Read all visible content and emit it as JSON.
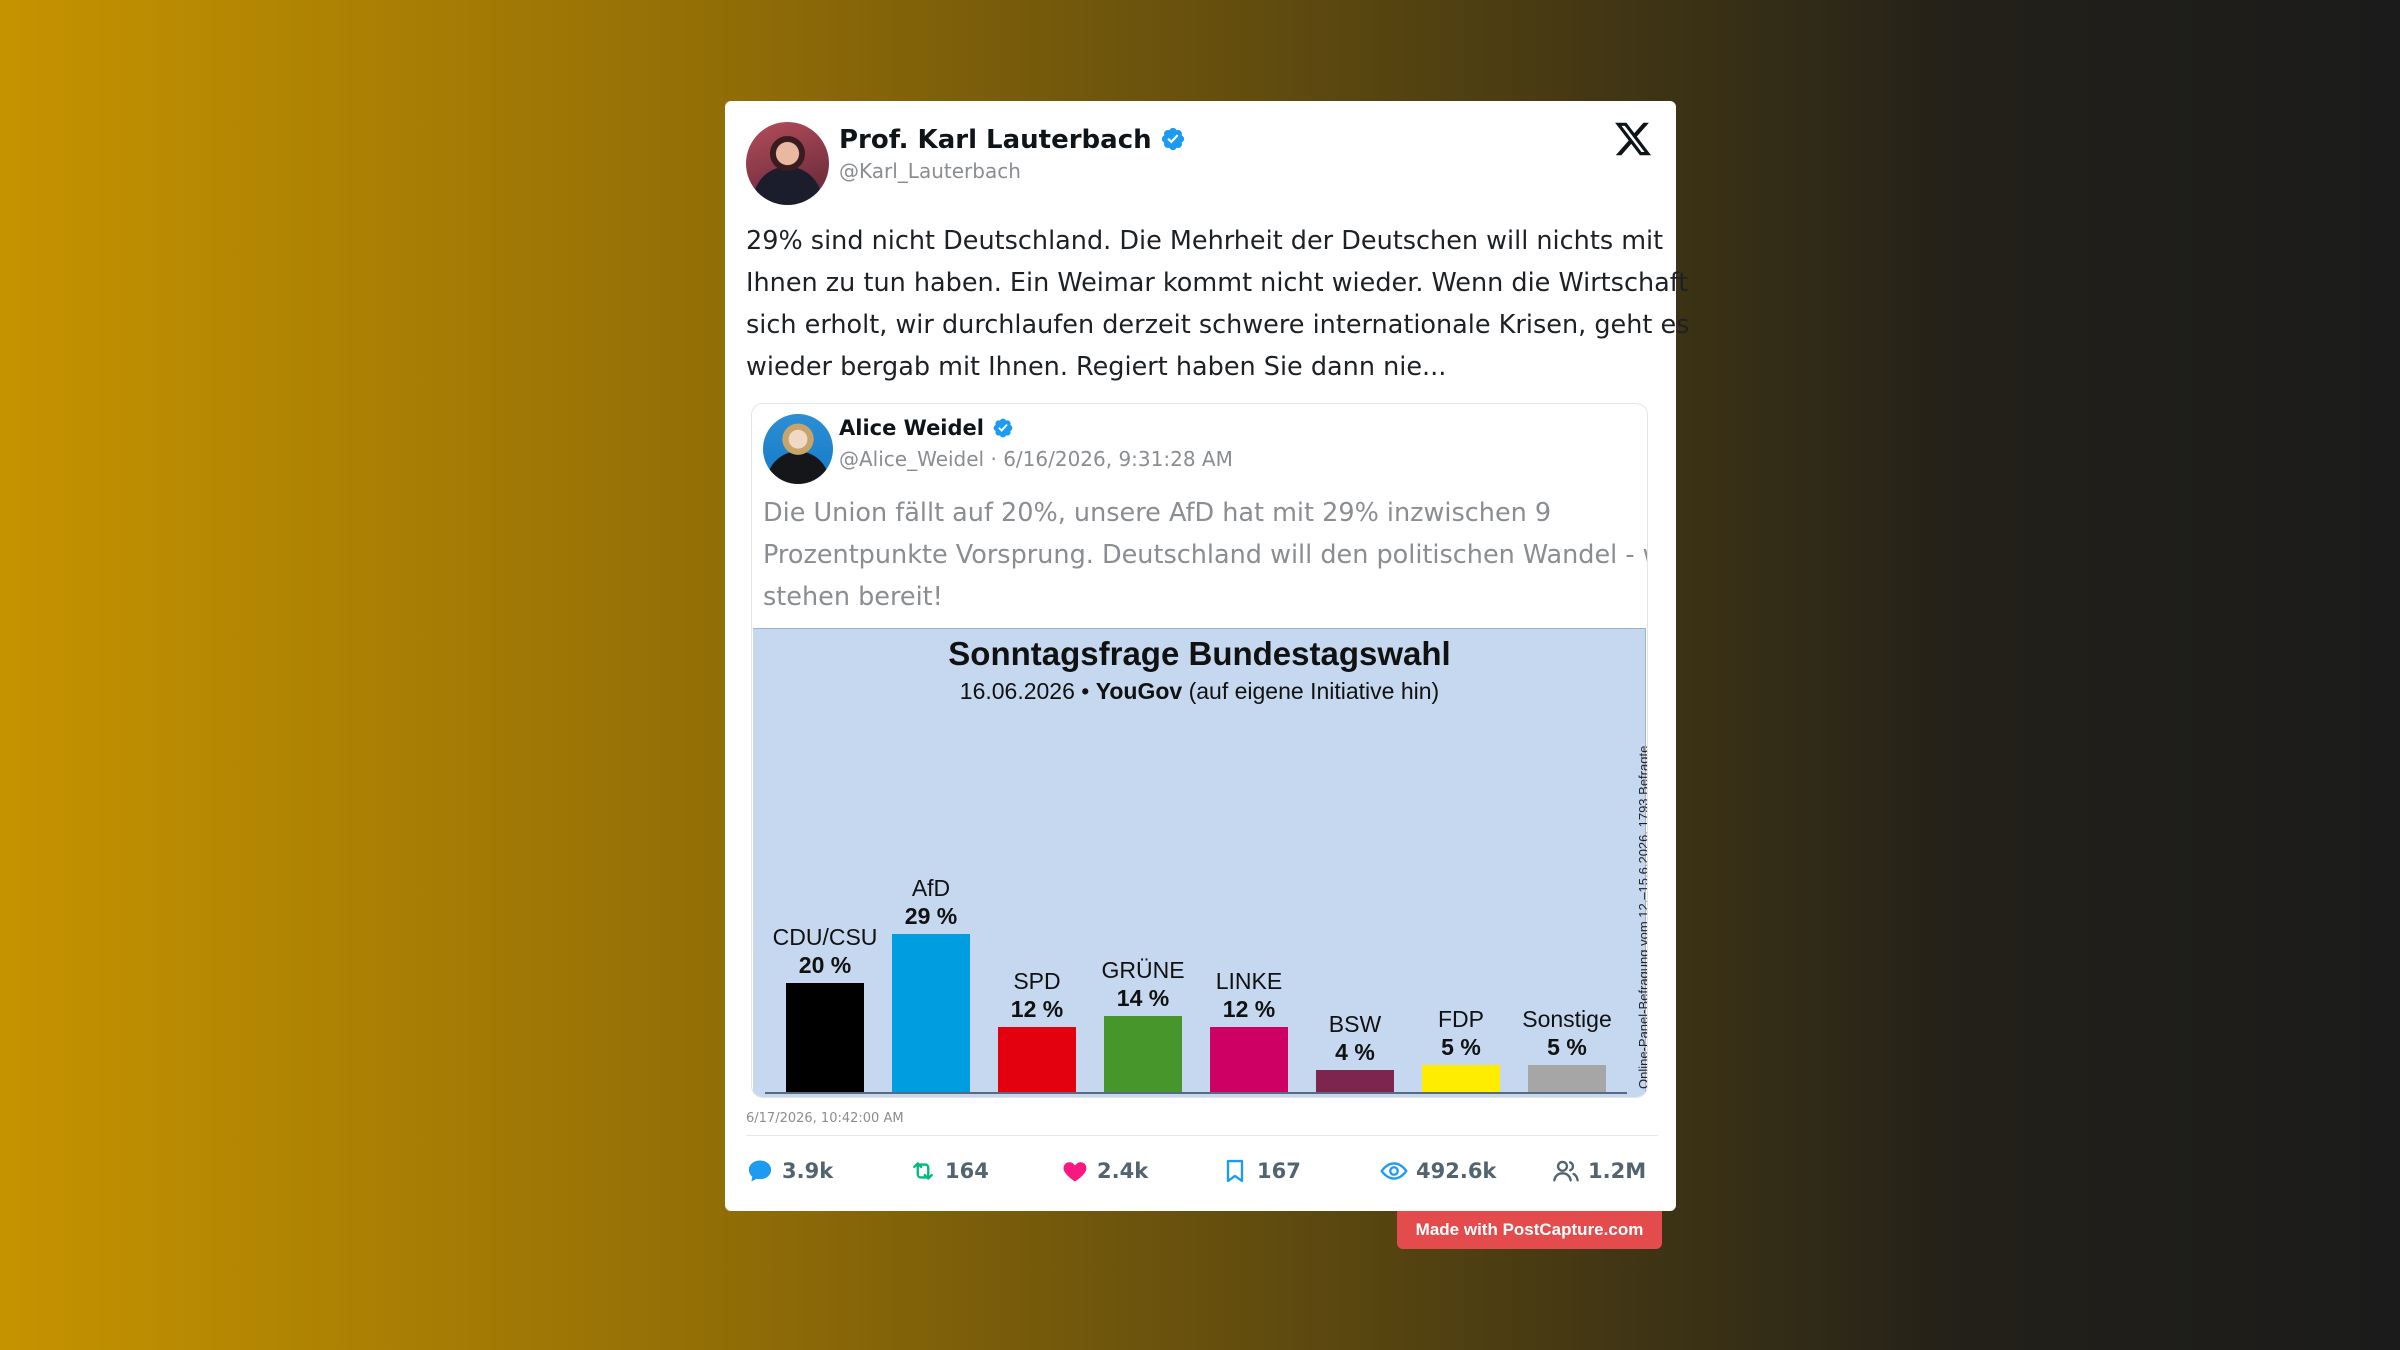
{
  "tweet": {
    "author_name": "Prof. Karl Lauterbach",
    "author_handle": "@Karl_Lauterbach",
    "text_lines": [
      "29% sind nicht Deutschland. Die Mehrheit der Deutschen will nichts mit",
      "Ihnen zu tun haben. Ein Weimar kommt nicht wieder. Wenn die Wirtschaft",
      "sich erholt, wir durchlaufen derzeit schwere internationale Krisen, geht es",
      "wieder bergab mit Ihnen. Regiert haben Sie dann nie..."
    ],
    "timestamp": "6/17/2026, 10:42:00 AM",
    "stats": {
      "replies": "3.9k",
      "retweets": "164",
      "likes": "2.4k",
      "bookmarks": "167",
      "views": "492.6k",
      "followers": "1.2M"
    }
  },
  "quoted": {
    "author_name": "Alice Weidel",
    "meta": "@Alice_Weidel · 6/16/2026, 9:31:28 AM",
    "text_lines": [
      "Die Union fällt auf 20%, unsere AfD hat mit 29% inzwischen 9",
      "Prozentpunkte Vorsprung. Deutschland will den politischen Wandel - wir",
      "stehen bereit!"
    ]
  },
  "chart_data": {
    "type": "bar",
    "title": "Sonntagsfrage Bundestagswahl",
    "subtitle_date": "16.06.2026 •",
    "subtitle_source": "YouGov",
    "subtitle_note": "(auf eigene Initiative hin)",
    "side_note": "Online-Panel-Befragung vom 12.–15.6.2026, 1793 Befragte",
    "categories": [
      "CDU/CSU",
      "AfD",
      "SPD",
      "GRÜNE",
      "LINKE",
      "BSW",
      "FDP",
      "Sonstige"
    ],
    "values": [
      20,
      29,
      12,
      14,
      12,
      4,
      5,
      5
    ],
    "value_labels": [
      "20 %",
      "29 %",
      "12 %",
      "14 %",
      "12 %",
      "4 %",
      "5 %",
      "5 %"
    ],
    "colors": [
      "#000000",
      "#009ee0",
      "#e3000f",
      "#46962b",
      "#cf0063",
      "#7d254f",
      "#ffed00",
      "#a6a6a6"
    ],
    "ylim": [
      0,
      29
    ],
    "background": "#c5d8ef"
  },
  "footer": {
    "badge": "Made with PostCapture.com"
  },
  "colors": {
    "verified": "#1d9bf0",
    "like": "#f91880",
    "retweet": "#00ba7c",
    "reply": "#1d9bf0"
  }
}
